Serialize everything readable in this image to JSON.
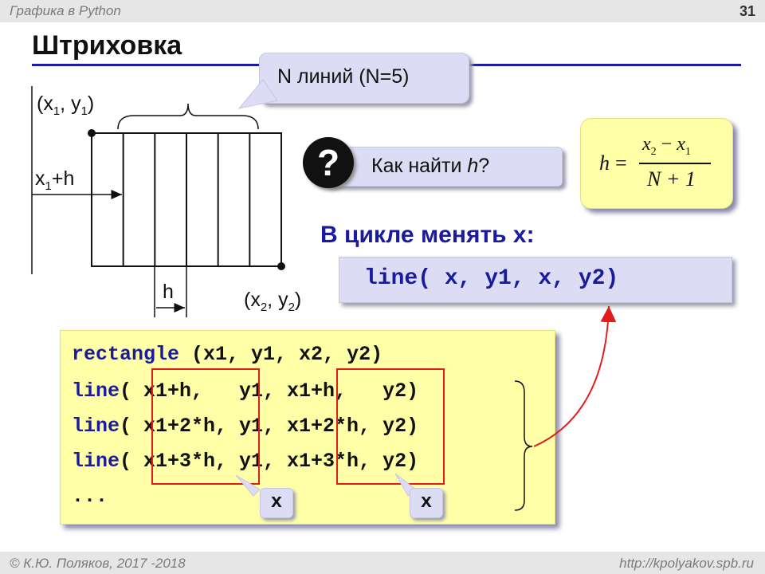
{
  "header": {
    "subject": "Графика в Python",
    "page_number": "31"
  },
  "title": "Штриховка",
  "callout": {
    "text": "N линий (N=5)"
  },
  "diagram": {
    "label_x1": "x",
    "label_x1_sub": "1",
    "label_y1": "y",
    "label_y1_sub": "1",
    "label_x1h_x": "x",
    "label_x1h_sub": "1",
    "label_x1h_rest": "+h",
    "label_h": "h",
    "label_x2": "x",
    "label_x2_sub": "2",
    "label_y2": "y",
    "label_y2_sub": "2",
    "line_count": 5
  },
  "question": {
    "icon": "?",
    "text_prefix": "Как найти ",
    "text_var": "h",
    "text_suffix": "?"
  },
  "formula": {
    "lhs": "h",
    "eq": "=",
    "num_a": "x",
    "num_a_sub": "2",
    "num_op": "−",
    "num_b": "x",
    "num_b_sub": "1",
    "den": "N + 1"
  },
  "loop_heading": "В цикле менять x:",
  "loop_code": "line( x, y1, x, y2)",
  "code_lines": {
    "l1_kw": "rectangle",
    "l1_rest": " (x1, y1, x2, y2)",
    "l2_kw": "line",
    "l2_rest": "( x1+h,   y1, x1+h,   y2)",
    "l3_kw": "line",
    "l3_rest": "( x1+2*h, y1, x1+2*h, y2)",
    "l4_kw": "line",
    "l4_rest": "( x1+3*h, y1, x1+3*h, y2)",
    "l5": "..."
  },
  "badges": {
    "left": "x",
    "right": "x"
  },
  "footer": {
    "author": "© К.Ю. Поляков, 2017 -2018",
    "site": "http://kpolyakov.spb.ru"
  }
}
